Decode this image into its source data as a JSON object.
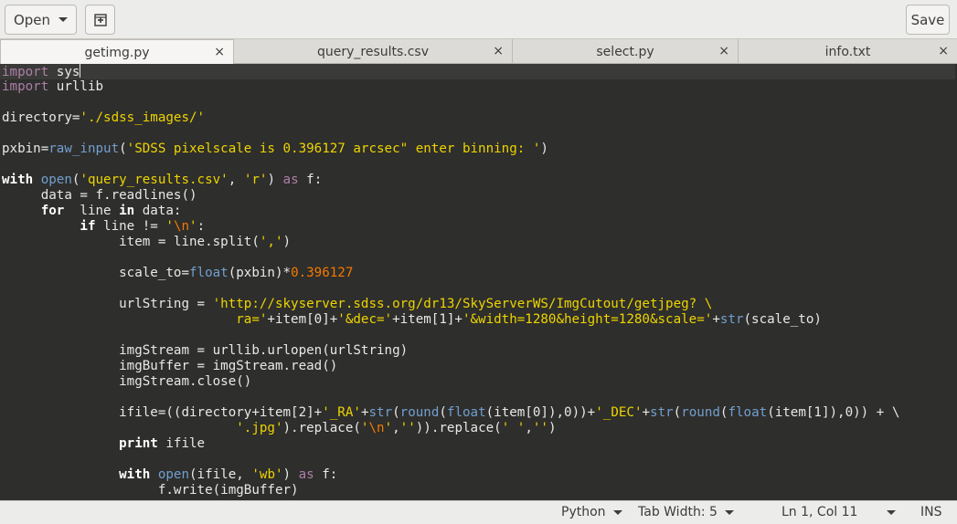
{
  "toolbar": {
    "open_label": "Open",
    "new_tab_icon": "new-document-icon",
    "save_label": "Save"
  },
  "tabs": [
    {
      "label": "getimg.py",
      "active": true
    },
    {
      "label": "query_results.csv",
      "active": false
    },
    {
      "label": "select.py",
      "active": false
    },
    {
      "label": "info.txt",
      "active": false
    }
  ],
  "tab_close_glyph": "×",
  "code_lines": [
    [
      [
        "kw",
        "import"
      ],
      [
        "",
        "sys"
      ]
    ],
    [
      [
        "kw",
        "import"
      ],
      [
        "",
        "urllib"
      ]
    ],
    [],
    [
      [
        "",
        "directory="
      ],
      [
        "str",
        "'./sdss_images/'"
      ]
    ],
    [],
    [
      [
        "",
        "pxbin="
      ],
      [
        "bi",
        "raw_input"
      ],
      [
        "",
        "("
      ],
      [
        "str",
        "'SDSS pixelscale is 0.396127 arcsec\" enter binning: '"
      ],
      [
        "",
        ")"
      ]
    ],
    [],
    [
      [
        "bold",
        "with"
      ],
      [
        "",
        ""
      ],
      [
        "bi",
        "open"
      ],
      [
        "",
        "("
      ],
      [
        "str",
        "'query_results.csv'"
      ],
      [
        "",
        ", "
      ],
      [
        "str",
        "'r'"
      ],
      [
        "",
        ") "
      ],
      [
        "kw",
        "as"
      ],
      [
        "",
        "f:"
      ]
    ],
    [
      [
        "",
        "     data = f.readlines()"
      ]
    ],
    [
      [
        "",
        "     "
      ],
      [
        "bold",
        "for"
      ],
      [
        "",
        " line "
      ],
      [
        "bold",
        "in"
      ],
      [
        "",
        ""
      ],
      [
        "",
        "data:"
      ]
    ],
    [
      [
        "",
        "          "
      ],
      [
        "bold",
        "if"
      ],
      [
        "",
        ""
      ],
      [
        "",
        "line != "
      ],
      [
        "str",
        "'"
      ],
      [
        "esc",
        "\\n"
      ],
      [
        "str",
        "'"
      ],
      [
        "",
        ":"
      ]
    ],
    [
      [
        "",
        "               item = line.split("
      ],
      [
        "str",
        "','"
      ],
      [
        "",
        ")"
      ]
    ],
    [],
    [
      [
        "",
        "               scale_to="
      ],
      [
        "bi",
        "float"
      ],
      [
        "",
        "(pxbin)*"
      ],
      [
        "num",
        "0.396127"
      ]
    ],
    [],
    [
      [
        "",
        "               urlString = "
      ],
      [
        "str",
        "'http://skyserver.sdss.org/dr13/SkyServerWS/ImgCutout/getjpeg? \\"
      ]
    ],
    [
      [
        "",
        "                              "
      ],
      [
        "str",
        "ra='"
      ],
      [
        "",
        "+item[0]+"
      ],
      [
        "str",
        "'&dec='"
      ],
      [
        "",
        "+item[1]+"
      ],
      [
        "str",
        "'&width=1280&height=1280&scale='"
      ],
      [
        "",
        "+"
      ],
      [
        "bi",
        "str"
      ],
      [
        "",
        "(scale_to)"
      ]
    ],
    [],
    [
      [
        "",
        "               imgStream = urllib.urlopen(urlString)"
      ]
    ],
    [
      [
        "",
        "               imgBuffer = imgStream.read()"
      ]
    ],
    [
      [
        "",
        "               imgStream.close()"
      ]
    ],
    [],
    [
      [
        "",
        "               ifile=((directory+item[2]+"
      ],
      [
        "str",
        "'_RA'"
      ],
      [
        "",
        "+"
      ],
      [
        "bi",
        "str"
      ],
      [
        "",
        "("
      ],
      [
        "bi",
        "round"
      ],
      [
        "",
        "("
      ],
      [
        "bi",
        "float"
      ],
      [
        "",
        "(item[0]),0))+"
      ],
      [
        "str",
        "'_DEC'"
      ],
      [
        "",
        "+"
      ],
      [
        "bi",
        "str"
      ],
      [
        "",
        "("
      ],
      [
        "bi",
        "round"
      ],
      [
        "",
        "("
      ],
      [
        "bi",
        "float"
      ],
      [
        "",
        "(item[1]),0)) + \\"
      ]
    ],
    [
      [
        "",
        "                              "
      ],
      [
        "str",
        "'.jpg'"
      ],
      [
        "",
        ").replace("
      ],
      [
        "str",
        "'"
      ],
      [
        "esc",
        "\\n"
      ],
      [
        "str",
        "'"
      ],
      [
        "",
        ","
      ],
      [
        "str",
        "''"
      ],
      [
        "",
        "))"
      ],
      [
        "",
        ".replace("
      ],
      [
        "str",
        "' '"
      ],
      [
        "",
        ","
      ],
      [
        "str",
        "''"
      ],
      [
        "",
        ")"
      ]
    ],
    [
      [
        "",
        "               "
      ],
      [
        "bold",
        "print"
      ],
      [
        "",
        ""
      ],
      [
        "",
        "ifile"
      ]
    ],
    [],
    [
      [
        "",
        "               "
      ],
      [
        "bold",
        "with"
      ],
      [
        "",
        ""
      ],
      [
        "bi",
        "open"
      ],
      [
        "",
        "(ifile, "
      ],
      [
        "str",
        "'wb'"
      ],
      [
        "",
        ") "
      ],
      [
        "kw",
        "as"
      ],
      [
        "",
        "f:"
      ]
    ],
    [
      [
        "",
        "                    f.write(imgBuffer)"
      ]
    ]
  ],
  "status": {
    "language": "Python",
    "tab_width": "Tab Width: 5",
    "position": "Ln 1, Col 11",
    "mode": "INS"
  }
}
